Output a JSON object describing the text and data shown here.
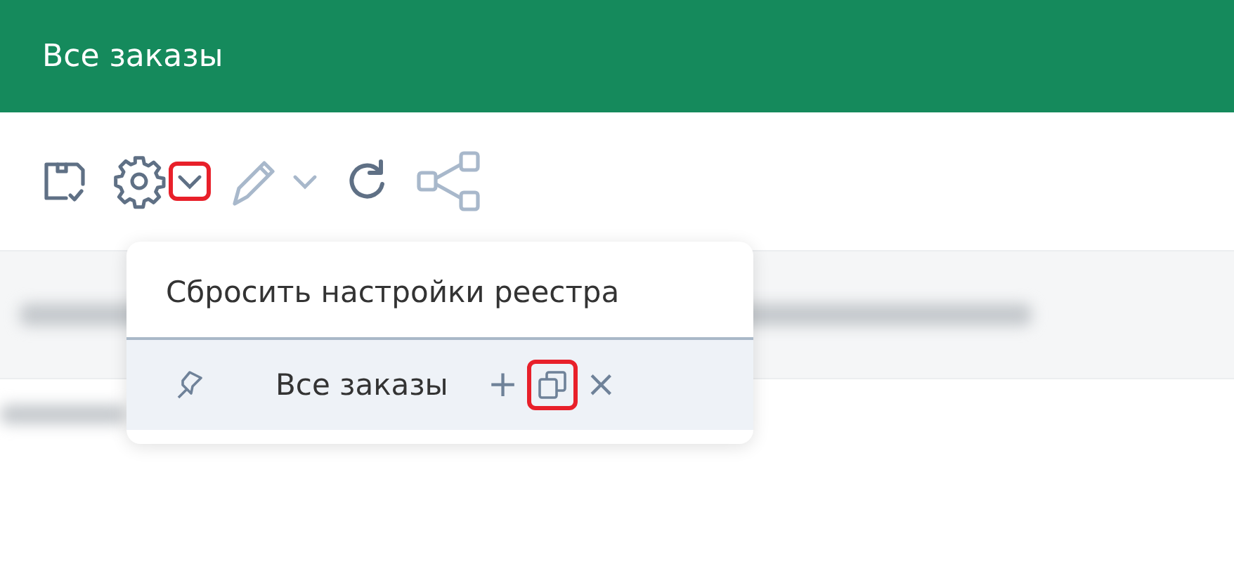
{
  "header": {
    "title": "Все заказы"
  },
  "toolbar": [
    {
      "kind": "save",
      "highlighted": false
    },
    {
      "kind": "settings",
      "highlighted": false
    },
    {
      "kind": "chevron",
      "highlighted": true
    },
    {
      "kind": "pencil",
      "highlighted": false
    },
    {
      "kind": "chevron-muted",
      "highlighted": false
    },
    {
      "kind": "refresh",
      "highlighted": false
    },
    {
      "kind": "share",
      "highlighted": false
    }
  ],
  "menu": {
    "reset_label": "Сбросить настройки реестра",
    "preset": {
      "name": "Все заказы",
      "actions": [
        {
          "kind": "add",
          "label": "+",
          "highlighted": false
        },
        {
          "kind": "copy",
          "highlighted": true
        },
        {
          "kind": "close",
          "label": "×",
          "highlighted": false
        }
      ]
    }
  }
}
